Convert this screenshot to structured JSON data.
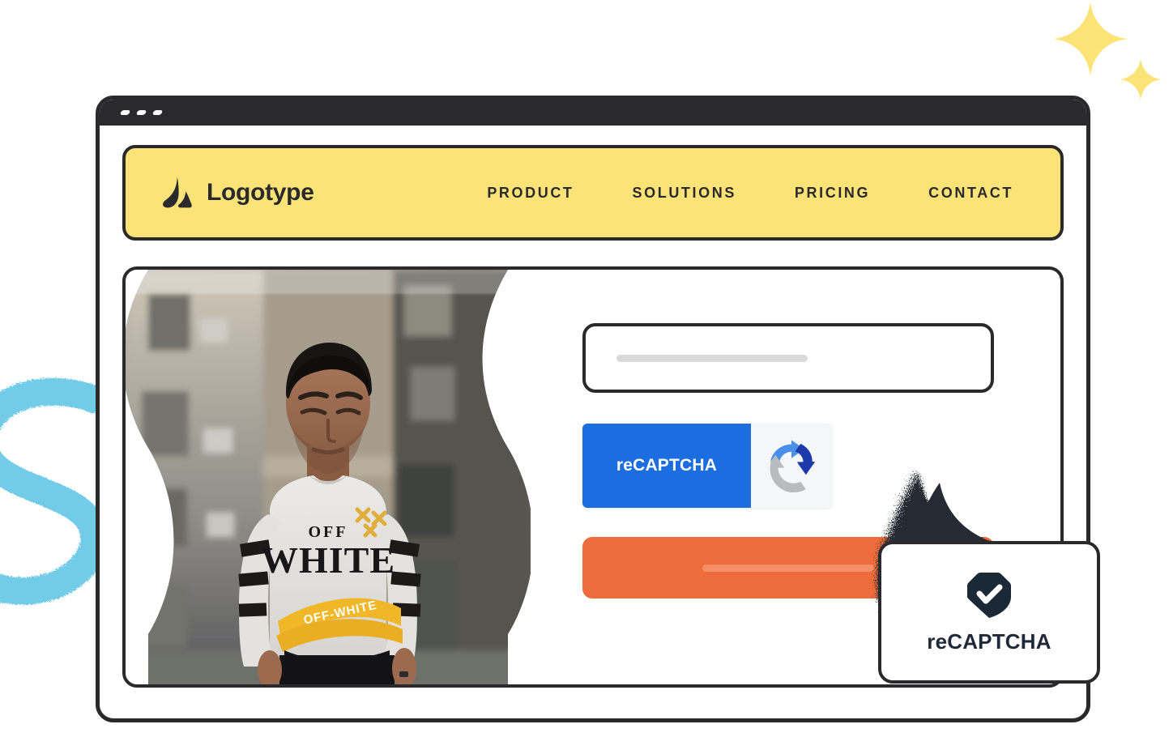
{
  "window": {
    "name": "browser-window",
    "dots": [
      "dot-1",
      "dot-2",
      "dot-3"
    ]
  },
  "site_header": {
    "brand_name": "Logotype",
    "brand_mark_icon": "logotype-flame-mark-icon",
    "background_color": "#FBE377",
    "nav": [
      {
        "label": "PRODUCT"
      },
      {
        "label": "SOLUTIONS"
      },
      {
        "label": "PRICING"
      },
      {
        "label": "CONTACT"
      }
    ]
  },
  "hero": {
    "image_alt": "young man in off-white sweatshirt standing on city street",
    "image_shape": "wavy-blob-mask"
  },
  "form": {
    "input": {
      "name": "text-input",
      "value": "",
      "placeholder": ""
    },
    "recaptcha_widget": {
      "label": "reCAPTCHA",
      "logo_icon": "recaptcha-arrows-icon",
      "panel_color": "#1B6DE0",
      "logo_pane_color": "#F5F6F7"
    },
    "submit_button": {
      "label": "",
      "color": "#EE6C3B"
    }
  },
  "floating_card": {
    "shield_icon": "shield-check-icon",
    "label": "reCAPTCHA",
    "shield_color": "#1B2836"
  },
  "decorations": {
    "sparkle_large": "sparkle-star-icon",
    "sparkle_small": "sparkle-star-small-icon",
    "squiggle": "blue-squiggle-decoration",
    "burst": "particle-burst-decoration",
    "sparkle_color": "#FBE377",
    "squiggle_color": "#72CCE8",
    "burst_color": "#262B33"
  },
  "theme": {
    "dark": "#2A2A2D",
    "yellow": "#FBE377",
    "orange": "#EE6C3B",
    "blue": "#1B6DE0",
    "light_blue": "#72CCE8"
  }
}
